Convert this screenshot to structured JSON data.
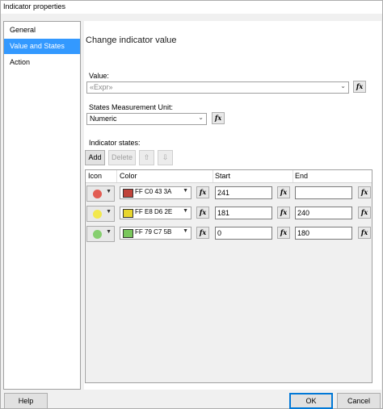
{
  "window": {
    "title": "Indicator properties"
  },
  "nav": {
    "items": [
      {
        "label": "General"
      },
      {
        "label": "Value and States"
      },
      {
        "label": "Action"
      }
    ]
  },
  "main": {
    "section_title": "Change indicator value",
    "value_label": "Value:",
    "value_placeholder": "«Expr»",
    "unit_label": "States Measurement Unit:",
    "unit_value": "Numeric",
    "states_label": "Indicator states:",
    "toolbar": {
      "add_label": "Add",
      "delete_label": "Delete"
    },
    "fx_label": "fx",
    "columns": {
      "icon": "Icon",
      "color": "Color",
      "start": "Start",
      "end": "End"
    },
    "rows": [
      {
        "dot_color": "#e25c52",
        "swatch": "#c0433a",
        "color_text": "FF C0 43 3A",
        "start": "241",
        "end": ""
      },
      {
        "dot_color": "#f2e84d",
        "swatch": "#e8d62e",
        "color_text": "FF E8 D6 2E",
        "start": "181",
        "end": "240"
      },
      {
        "dot_color": "#86cf6f",
        "swatch": "#79c75b",
        "color_text": "FF 79 C7 5B",
        "start": "0",
        "end": "180"
      }
    ]
  },
  "footer": {
    "help_label": "Help",
    "ok_label": "OK",
    "cancel_label": "Cancel"
  }
}
